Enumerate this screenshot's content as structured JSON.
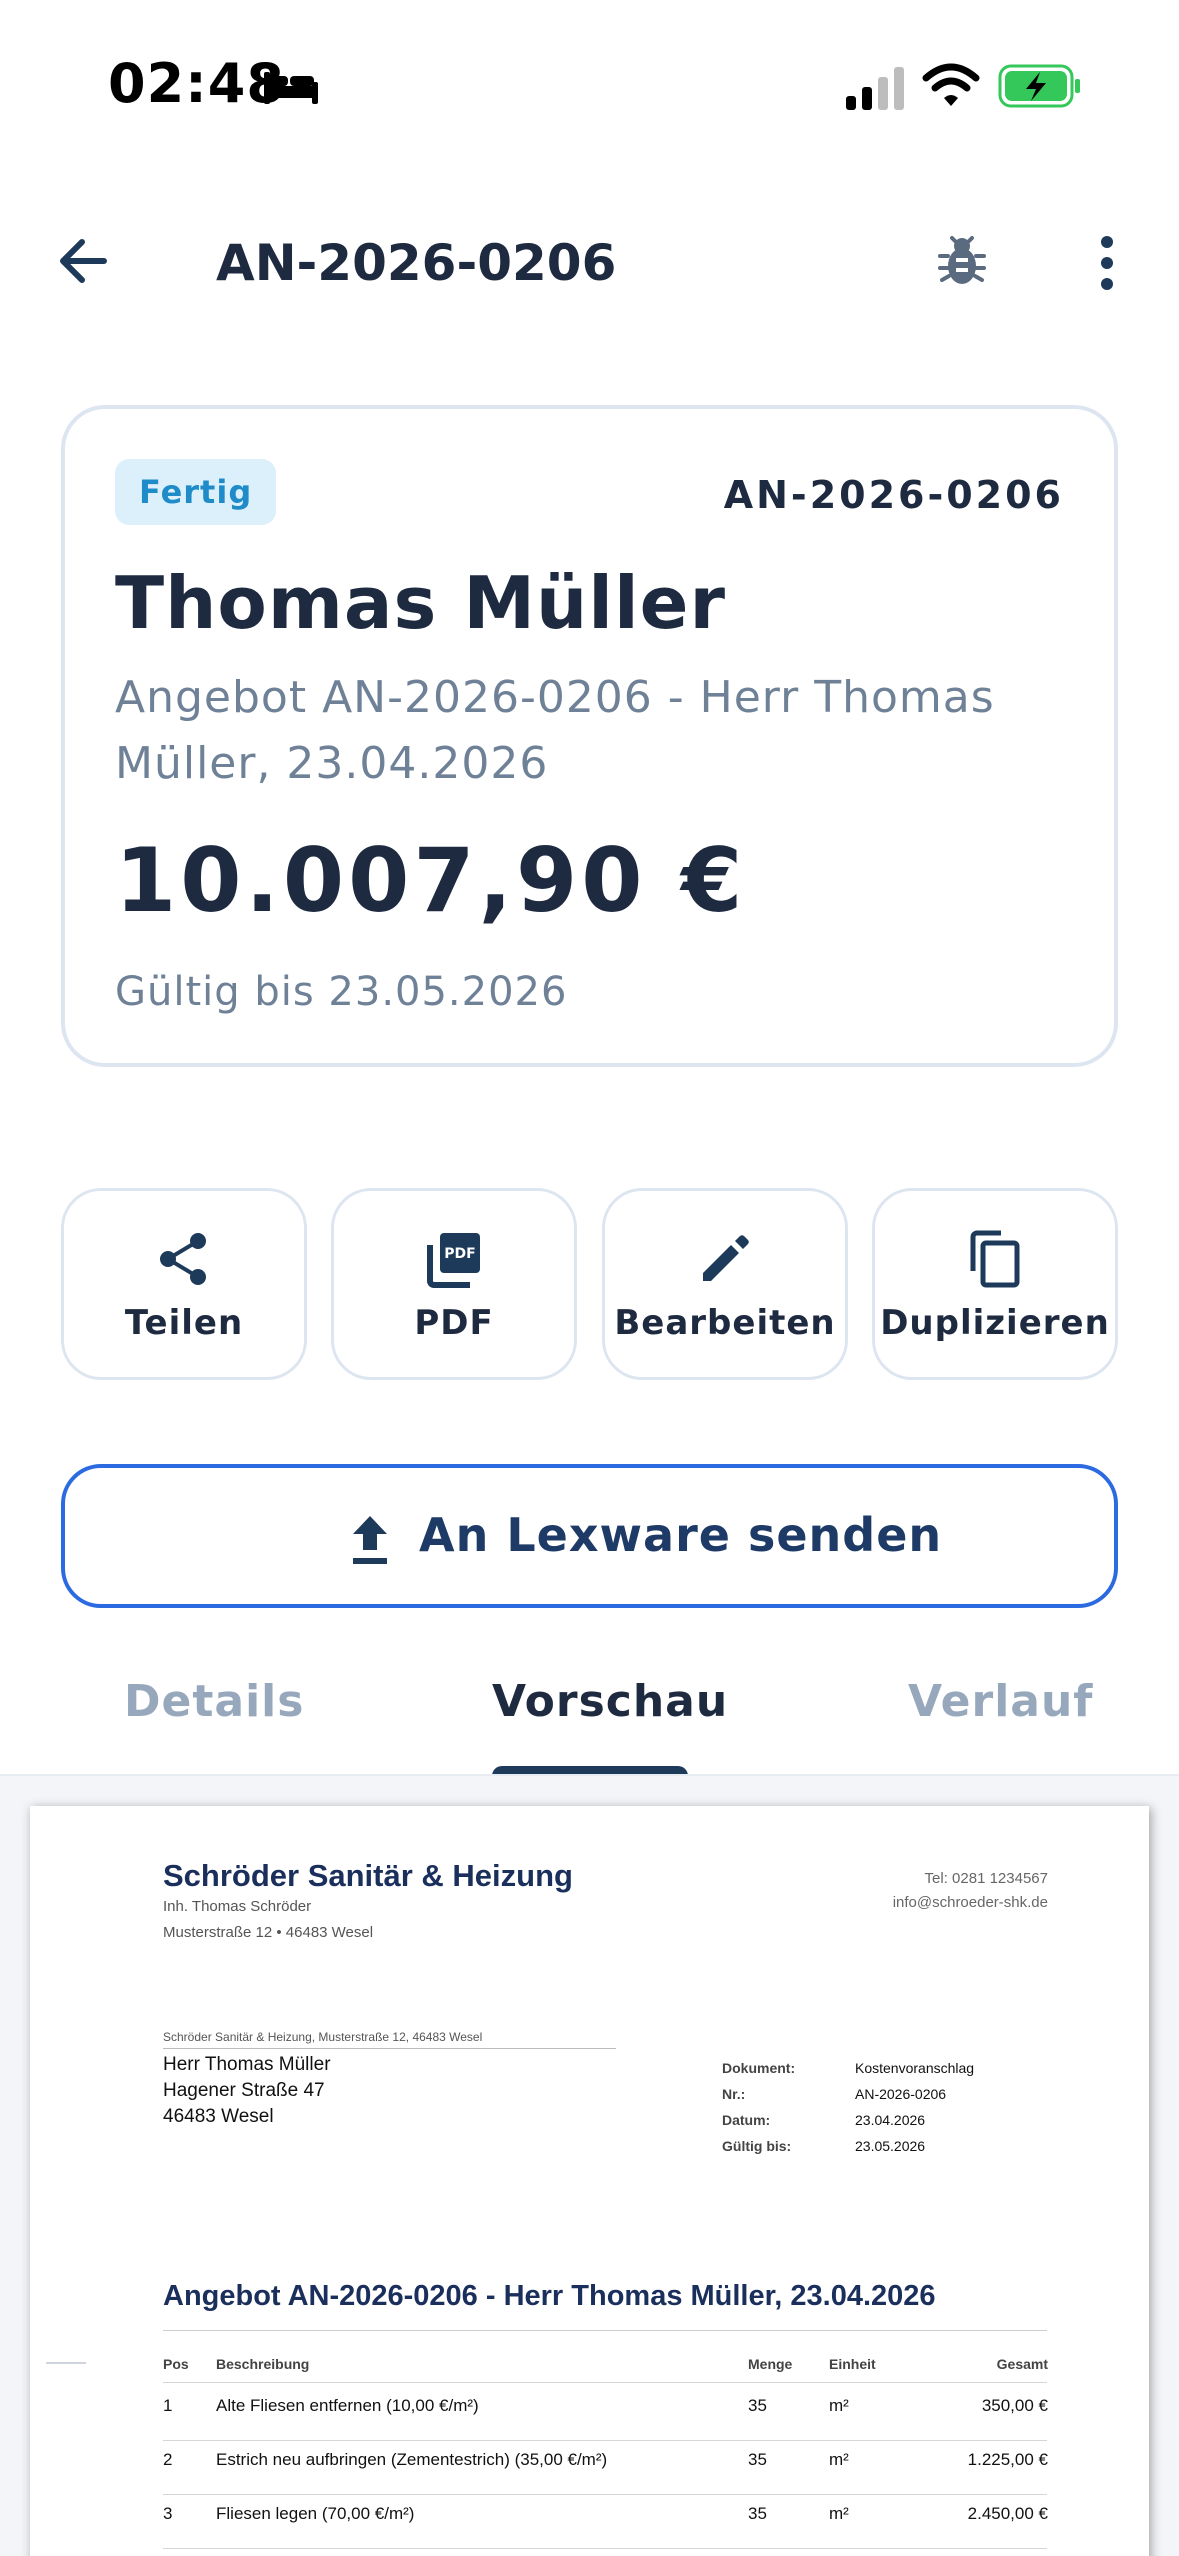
{
  "status_bar": {
    "time": "02:48",
    "focus_icon": "bed-icon",
    "signal_icon": "cellular-signal-icon",
    "wifi_icon": "wifi-icon",
    "battery_icon": "battery-charging-icon",
    "battery_color": "#34c759"
  },
  "app_bar": {
    "title": "AN-2026-0206",
    "back_icon": "arrow-left-icon",
    "debug_icon": "bug-icon",
    "more_icon": "more-vertical-icon"
  },
  "summary": {
    "status": "Fertig",
    "number": "AN-2026-0206",
    "customer": "Thomas Müller",
    "subtitle": "Angebot AN-2026-0206 - Herr Thomas Müller, 23.04.2026",
    "amount": "10.007,90 €",
    "valid_until": "Gültig bis 23.05.2026",
    "status_color": "#1f8cc9"
  },
  "actions": [
    {
      "label": "Teilen",
      "icon": "share-icon"
    },
    {
      "label": "PDF",
      "icon": "pdf-icon"
    },
    {
      "label": "Bearbeiten",
      "icon": "edit-pencil-icon"
    },
    {
      "label": "Duplizieren",
      "icon": "copy-icon"
    }
  ],
  "send": {
    "label": "An Lexware senden",
    "icon": "upload-icon",
    "border_color": "#2b6ae0"
  },
  "tabs": [
    {
      "label": "Details",
      "active": false
    },
    {
      "label": "Vorschau",
      "active": true
    },
    {
      "label": "Verlauf",
      "active": false
    }
  ],
  "document": {
    "company": {
      "name": "Schröder Sanitär & Heizung",
      "owner": "Inh. Thomas Schröder",
      "address": "Musterstraße 12 • 46483 Wesel",
      "tel": "Tel: 0281 1234567",
      "email": "info@schroeder-shk.de"
    },
    "sender_line": "Schröder Sanitär & Heizung, Musterstraße 12, 46483 Wesel",
    "recipient": [
      "Herr Thomas Müller",
      "Hagener Straße 47",
      "46483 Wesel"
    ],
    "meta": [
      {
        "label": "Dokument:",
        "value": "Kostenvoranschlag"
      },
      {
        "label": "Nr.:",
        "value": "AN-2026-0206"
      },
      {
        "label": "Datum:",
        "value": "23.04.2026"
      },
      {
        "label": "Gültig bis:",
        "value": "23.05.2026"
      }
    ],
    "heading": "Angebot AN-2026-0206 - Herr Thomas Müller, 23.04.2026",
    "table": {
      "headers": {
        "pos": "Pos",
        "desc": "Beschreibung",
        "qty": "Menge",
        "unit": "Einheit",
        "total": "Gesamt"
      },
      "rows": [
        {
          "pos": "1",
          "desc": "Alte Fliesen entfernen (10,00 €/m²)",
          "qty": "35",
          "unit": "m²",
          "total": "350,00 €"
        },
        {
          "pos": "2",
          "desc": "Estrich neu aufbringen (Zementestrich) (35,00 €/m²)",
          "qty": "35",
          "unit": "m²",
          "total": "1.225,00 €"
        },
        {
          "pos": "3",
          "desc": "Fliesen legen (70,00 €/m²)",
          "qty": "35",
          "unit": "m²",
          "total": "2.450,00 €"
        }
      ]
    }
  }
}
